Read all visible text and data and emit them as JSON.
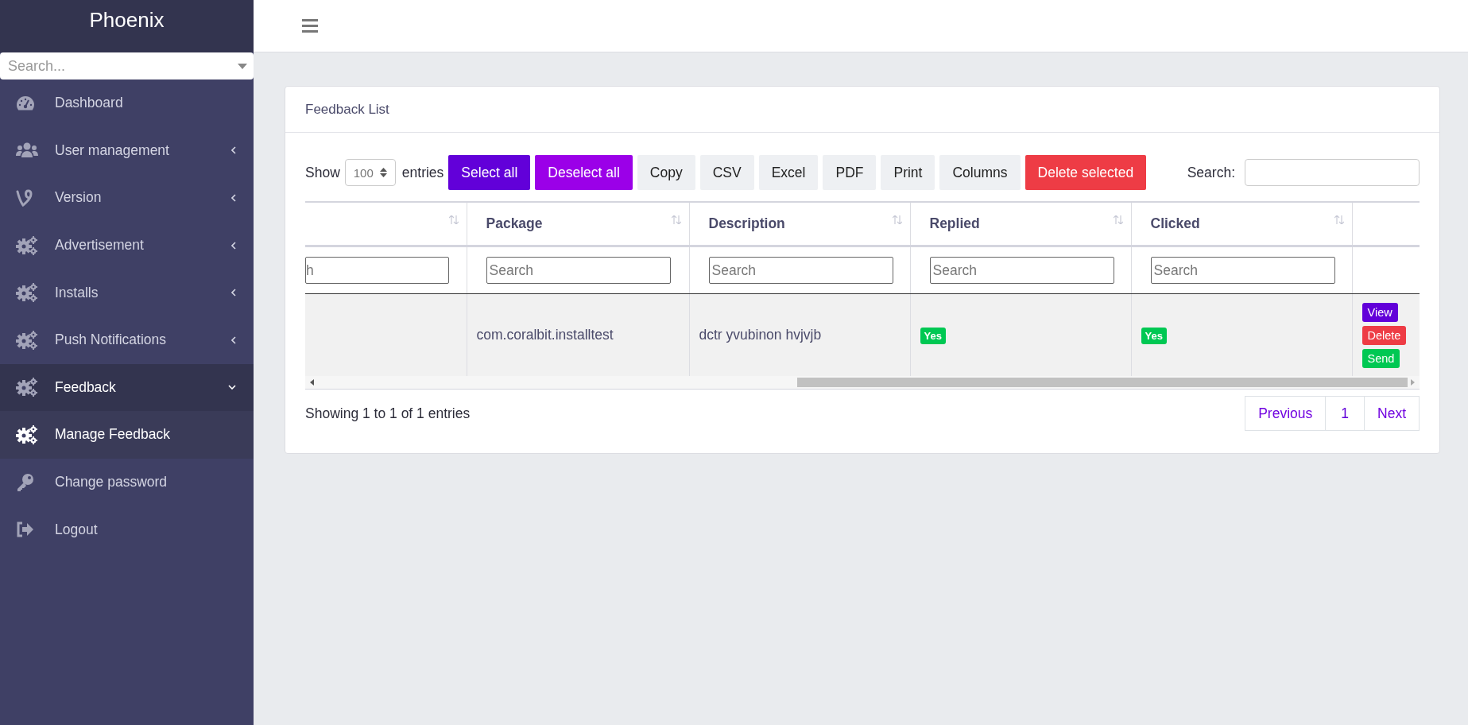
{
  "sidebar": {
    "brand": "Phoenix",
    "search": {
      "placeholder": "Search..."
    },
    "items": [
      {
        "label": "Dashboard",
        "selected": false
      },
      {
        "label": "User management",
        "expanded": false,
        "selected": false
      },
      {
        "label": "Version",
        "expanded": false,
        "selected": false
      },
      {
        "label": "Advertisement",
        "expanded": false,
        "selected": false
      },
      {
        "label": "Installs",
        "expanded": false,
        "selected": false
      },
      {
        "label": "Push Notifications",
        "expanded": false,
        "selected": false
      },
      {
        "label": "Feedback",
        "expanded": true,
        "selected": false,
        "children": [
          {
            "label": "Manage Feedback",
            "selected": true
          }
        ]
      },
      {
        "label": "Change password",
        "selected": false
      },
      {
        "label": "Logout",
        "selected": false
      }
    ]
  },
  "card": {
    "title": "Feedback List",
    "length": {
      "before": "Show",
      "value": "100",
      "after": "entries"
    },
    "buttons": [
      {
        "label": "Select all",
        "kind": "primary"
      },
      {
        "label": "Deselect all",
        "kind": "secondary"
      },
      {
        "label": "Copy",
        "kind": "plain"
      },
      {
        "label": "CSV",
        "kind": "plain"
      },
      {
        "label": "Excel",
        "kind": "plain"
      },
      {
        "label": "PDF",
        "kind": "plain"
      },
      {
        "label": "Print",
        "kind": "plain"
      },
      {
        "label": "Columns",
        "kind": "plain"
      },
      {
        "label": "Delete selected",
        "kind": "danger"
      }
    ],
    "search": {
      "label": "Search:"
    },
    "table": {
      "columns": [
        {
          "placeholder": "h"
        },
        {
          "label": "Package",
          "placeholder": "Search"
        },
        {
          "label": "Description",
          "placeholder": "Search"
        },
        {
          "label": "Replied",
          "placeholder": "Search"
        },
        {
          "label": "Clicked",
          "placeholder": "Search"
        },
        {}
      ],
      "rows": [
        {
          "package": "com.coralbit.installtest",
          "description": "dctr yvubinon hvjvjb",
          "replied": {
            "text": "Yes",
            "color": "#00c853"
          },
          "clicked": {
            "text": "Yes",
            "color": "#00c853"
          },
          "actions": [
            {
              "label": "View",
              "kind": "view"
            },
            {
              "label": "Delete",
              "kind": "delete"
            },
            {
              "label": "Send",
              "kind": "send"
            }
          ]
        }
      ]
    },
    "info": "Showing 1 to 1 of 1 entries",
    "pagination": [
      {
        "label": "Previous",
        "selected": false
      },
      {
        "label": "1",
        "selected": true
      },
      {
        "label": "Next",
        "selected": false
      }
    ]
  }
}
